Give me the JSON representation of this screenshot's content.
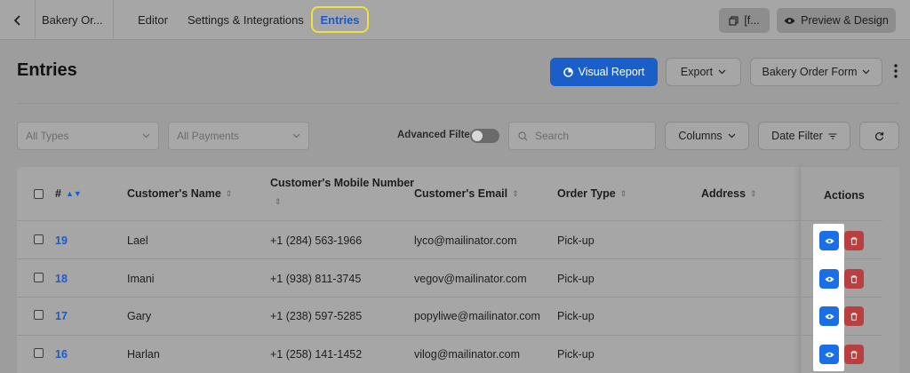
{
  "topbar": {
    "back_icon": "chevron-left-icon",
    "form_name": "Bakery Or...",
    "nav": [
      "Editor",
      "Settings & Integrations",
      "Entries"
    ],
    "active_nav": "Entries",
    "shortcode_label": "[f...",
    "preview_label": "Preview & Design"
  },
  "header": {
    "title": "Entries",
    "visual_report_label": "Visual Report",
    "export_label": "Export",
    "form_select_label": "Bakery Order Form"
  },
  "filters": {
    "types_placeholder": "All Types",
    "payments_placeholder": "All Payments",
    "advanced_filter_label": "Advanced Filter",
    "search_placeholder": "Search",
    "columns_label": "Columns",
    "date_filter_label": "Date Filter"
  },
  "table": {
    "columns": {
      "id": "#",
      "name": "Customer's Name",
      "mobile": "Customer's Mobile Number",
      "email": "Customer's Email",
      "order_type": "Order Type",
      "address": "Address",
      "actions": "Actions"
    },
    "rows": [
      {
        "id": "19",
        "name": "Lael",
        "mobile": "+1 (284) 563-1966",
        "email": "lyco@mailinator.com",
        "order_type": "Pick-up",
        "address": ""
      },
      {
        "id": "18",
        "name": "Imani",
        "mobile": "+1 (938) 811-3745",
        "email": "vegov@mailinator.com",
        "order_type": "Pick-up",
        "address": ""
      },
      {
        "id": "17",
        "name": "Gary",
        "mobile": "+1 (238) 597-5285",
        "email": "popyliwe@mailinator.com",
        "order_type": "Pick-up",
        "address": ""
      },
      {
        "id": "16",
        "name": "Harlan",
        "mobile": "+1 (258) 141-1452",
        "email": "vilog@mailinator.com",
        "order_type": "Pick-up",
        "address": ""
      }
    ]
  },
  "colors": {
    "primary": "#1a5fc9",
    "view_button": "#1a6fe6",
    "delete_button": "#b84040",
    "active_tab_outline": "#f0e040"
  }
}
